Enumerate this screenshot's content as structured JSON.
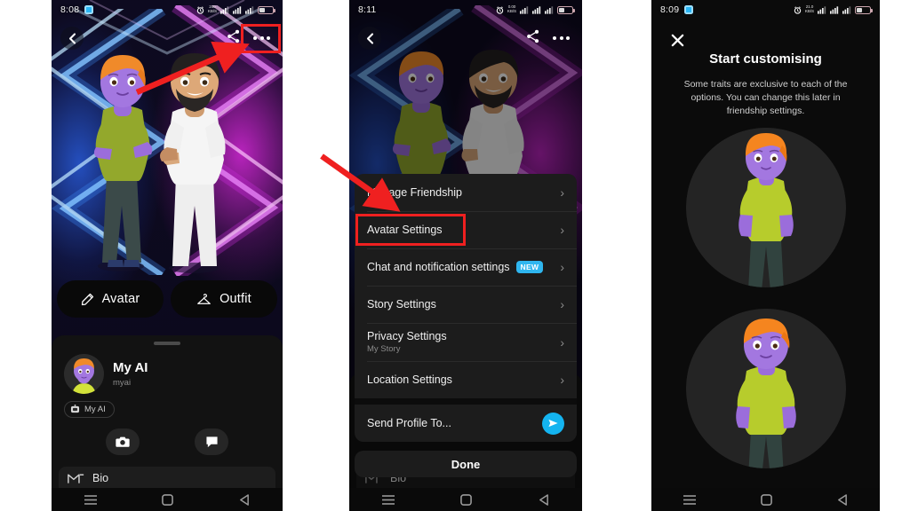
{
  "panels": {
    "left": {
      "status": {
        "time": "8:08",
        "speed_top": "240",
        "speed_bottom": "KB/S",
        "battery": "bat"
      },
      "back_icon": "back-chevron-icon",
      "share_icon": "share-icon",
      "more_icon": "more-options-icon",
      "pills": [
        {
          "icon": "pencil-icon",
          "label": "Avatar"
        },
        {
          "icon": "hanger-icon",
          "label": "Outfit"
        }
      ],
      "profile": {
        "name": "My AI",
        "handle": "myai",
        "chip_label": "My AI",
        "chip_icon": "robot-icon",
        "camera_icon": "camera-icon",
        "chat_icon": "chat-bubble-icon",
        "bio_label": "Bio",
        "bio_icon": "bio-icon"
      },
      "nav": {
        "recents_icon": "recents-icon",
        "home_icon": "home-icon",
        "back_icon": "back-triangle-icon"
      }
    },
    "middle": {
      "status": {
        "time": "8:11",
        "speed_top": "0.00",
        "speed_bottom": "KB/S"
      },
      "back_icon": "back-chevron-icon",
      "share_icon": "share-icon",
      "more_icon": "more-options-icon",
      "menu_items": [
        {
          "label": "Manage Friendship",
          "sub": "",
          "badge": "",
          "trailing": "chevron"
        },
        {
          "label": "Avatar Settings",
          "sub": "",
          "badge": "",
          "trailing": "chevron"
        },
        {
          "label": "Chat and notification settings",
          "sub": "",
          "badge": "NEW",
          "trailing": "chevron"
        },
        {
          "label": "Story Settings",
          "sub": "",
          "badge": "",
          "trailing": "chevron"
        },
        {
          "label": "Privacy Settings",
          "sub": "My Story",
          "badge": "",
          "trailing": "chevron"
        },
        {
          "label": "Location Settings",
          "sub": "",
          "badge": "",
          "trailing": "chevron"
        },
        {
          "label": "Send Profile To...",
          "sub": "",
          "badge": "",
          "trailing": "send"
        }
      ],
      "done_label": "Done",
      "bio_label": "Bio",
      "nav": {
        "recents_icon": "recents-icon",
        "home_icon": "home-icon",
        "back_icon": "back-triangle-icon"
      }
    },
    "right": {
      "status": {
        "time": "8:09",
        "speed_top": "21.0",
        "speed_bottom": "KB/S"
      },
      "close_icon": "close-x-icon",
      "title": "Start customising",
      "body": "Some traits are exclusive to each of the options. You can change this later in friendship settings.",
      "avatar_option_1": "avatar-option-1",
      "avatar_option_2": "avatar-option-2",
      "nav": {
        "recents_icon": "recents-icon",
        "home_icon": "home-icon",
        "back_icon": "back-triangle-icon"
      }
    }
  },
  "annotations": {
    "highlight_color": "#ef2020",
    "left_arrow_target": "more-options-icon",
    "middle_arrow_target": "avatar-settings-menu-item"
  }
}
